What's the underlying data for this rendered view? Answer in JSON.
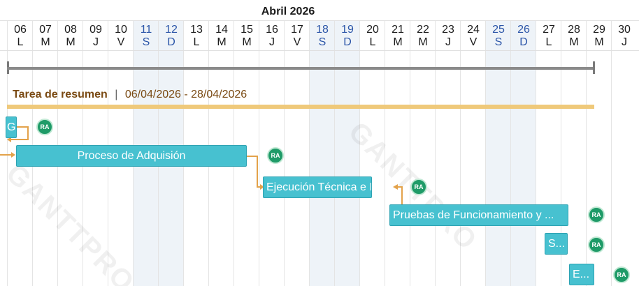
{
  "month_label": "Abril 2026",
  "days": [
    {
      "num": "06",
      "letter": "L",
      "weekend": false
    },
    {
      "num": "07",
      "letter": "M",
      "weekend": false
    },
    {
      "num": "08",
      "letter": "M",
      "weekend": false
    },
    {
      "num": "09",
      "letter": "J",
      "weekend": false
    },
    {
      "num": "10",
      "letter": "V",
      "weekend": false
    },
    {
      "num": "11",
      "letter": "S",
      "weekend": true
    },
    {
      "num": "12",
      "letter": "D",
      "weekend": true
    },
    {
      "num": "13",
      "letter": "L",
      "weekend": false
    },
    {
      "num": "14",
      "letter": "M",
      "weekend": false
    },
    {
      "num": "15",
      "letter": "M",
      "weekend": false
    },
    {
      "num": "16",
      "letter": "J",
      "weekend": false
    },
    {
      "num": "17",
      "letter": "V",
      "weekend": false
    },
    {
      "num": "18",
      "letter": "S",
      "weekend": true
    },
    {
      "num": "19",
      "letter": "D",
      "weekend": true
    },
    {
      "num": "20",
      "letter": "L",
      "weekend": false
    },
    {
      "num": "21",
      "letter": "M",
      "weekend": false
    },
    {
      "num": "22",
      "letter": "M",
      "weekend": false
    },
    {
      "num": "23",
      "letter": "J",
      "weekend": false
    },
    {
      "num": "24",
      "letter": "V",
      "weekend": false
    },
    {
      "num": "25",
      "letter": "S",
      "weekend": true
    },
    {
      "num": "26",
      "letter": "D",
      "weekend": true
    },
    {
      "num": "27",
      "letter": "L",
      "weekend": false
    },
    {
      "num": "28",
      "letter": "M",
      "weekend": false
    },
    {
      "num": "29",
      "letter": "M",
      "weekend": false
    },
    {
      "num": "30",
      "letter": "J",
      "weekend": false
    }
  ],
  "summary": {
    "title": "Tarea de resumen",
    "separator": "|",
    "dates": "06/04/2026 - 28/04/2026"
  },
  "tasks": [
    {
      "label": "G",
      "assignee": "RA"
    },
    {
      "label": "Proceso de Adquisión",
      "assignee": "RA"
    },
    {
      "label": "Ejecución Técnica e I...",
      "assignee": "RA"
    },
    {
      "label": "Pruebas de Funcionamiento y ...",
      "assignee": "RA"
    },
    {
      "label": "S...",
      "assignee": "RA"
    },
    {
      "label": "E...",
      "assignee": "RA"
    }
  ],
  "watermark_text": "GANTTPRO",
  "colors": {
    "task_bar": "#47c1d0",
    "summary_bar": "#efc97a",
    "link_line": "#e3a24a",
    "avatar": "#1f9b68",
    "weekend_bg": "#eef3f8",
    "weekend_text": "#2b55a8"
  }
}
